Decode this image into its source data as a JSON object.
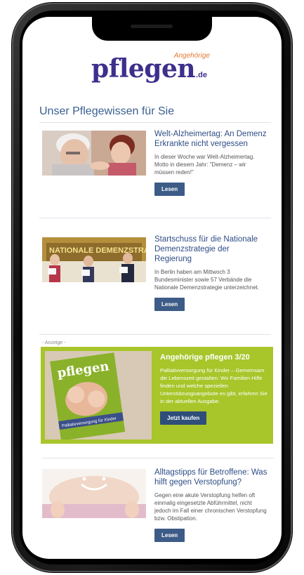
{
  "logo": {
    "wordmark": "pflegen",
    "tagline": "Angehörige",
    "tld": ".de"
  },
  "section_title": "Unser Pflegewissen für Sie",
  "articles": [
    {
      "title": "Welt-Alzheimertag: An Demenz Erkrankte nicht vergessen",
      "text": "In dieser Woche war Welt-Alzheimertag. Motto in diesem Jahr: \"Demenz – wir müssen reden!\"",
      "button": "Lesen"
    },
    {
      "title": "Startschuss für die Nationale Demenzstrategie der Regierung",
      "text": "In Berlin haben am Mittwoch 3 Bundesminister sowie 57 Verbände die Nationale Demenzstrategie unterzeichnet.",
      "button": "Lesen",
      "image_text": "NATIONALE DEMENZSTRA"
    },
    {
      "title": "Alltagstipps für Betroffene: Was hilft gegen Verstopfung?",
      "text": "Gegen eine akute Verstopfung helfen oft einmalig eingesetzte Abführmittel, nicht jedoch im Fall einer chronischen Verstopfung bzw. Obstipation.",
      "button": "Lesen"
    }
  ],
  "ad": {
    "label": "- Anzeige -",
    "title": "Angehörige pflegen 3/20",
    "text": "Palliativversorgung für Kinder – Gemeinsam die Lebenszeit gestalten: Wo Familien Hilfe finden und welche speziellen Unterstützungsangebote es gibt, erfahren Sie in der aktuellen Ausgabe.",
    "button": "Jetzt kaufen",
    "cover_title": "pflegen",
    "cover_strip": "Palliativversorgung für Kinder"
  },
  "colors": {
    "brand_purple": "#3d2f8c",
    "brand_orange": "#e17a33",
    "title_blue": "#2e4d85",
    "button_blue": "#3d5b87",
    "ad_green": "#a8c52a"
  }
}
